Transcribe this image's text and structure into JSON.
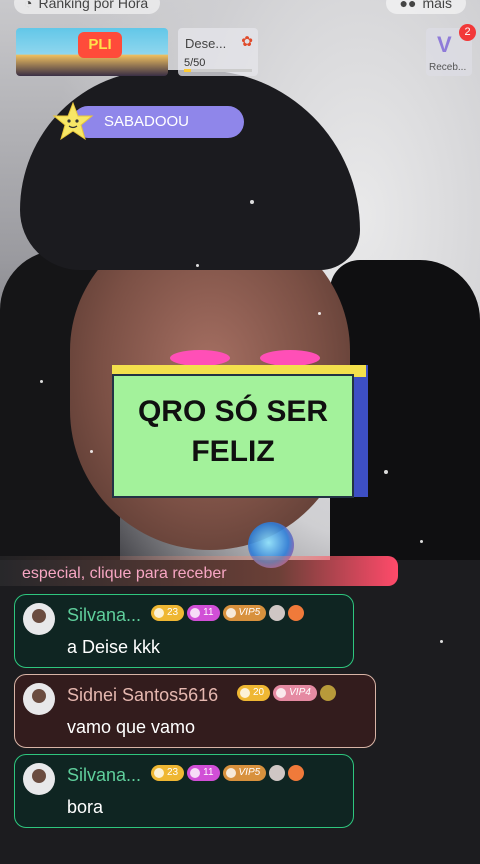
{
  "top": {
    "ranking_label": "Ranking por Hora",
    "more_label": "mais"
  },
  "goal": {
    "title": "Dese...",
    "progress_text": "5/50",
    "progress_fraction": 0.1
  },
  "receive": {
    "label": "Receb...",
    "badge": "2"
  },
  "sabadoou": "SABADOOU",
  "sign": {
    "line1": "QRO SÓ SER",
    "line2": "FELIZ"
  },
  "banner_logo": "PLI",
  "special": "especial, clique para receber",
  "messages": [
    {
      "name": "Silvana...",
      "text": "a Deise kkk",
      "badges": [
        "23",
        "11",
        "VIP5"
      ]
    },
    {
      "name": "Sidnei Santos5616",
      "text": "vamo que vamo",
      "badges": [
        "20",
        "VIP4"
      ]
    },
    {
      "name": "Silvana...",
      "text": "bora",
      "badges": [
        "23",
        "11",
        "VIP5"
      ]
    }
  ],
  "colors": {
    "accent_green": "#2ec67e",
    "sign_bg": "#a3f29b",
    "pill_purple": "#8f86ea"
  }
}
